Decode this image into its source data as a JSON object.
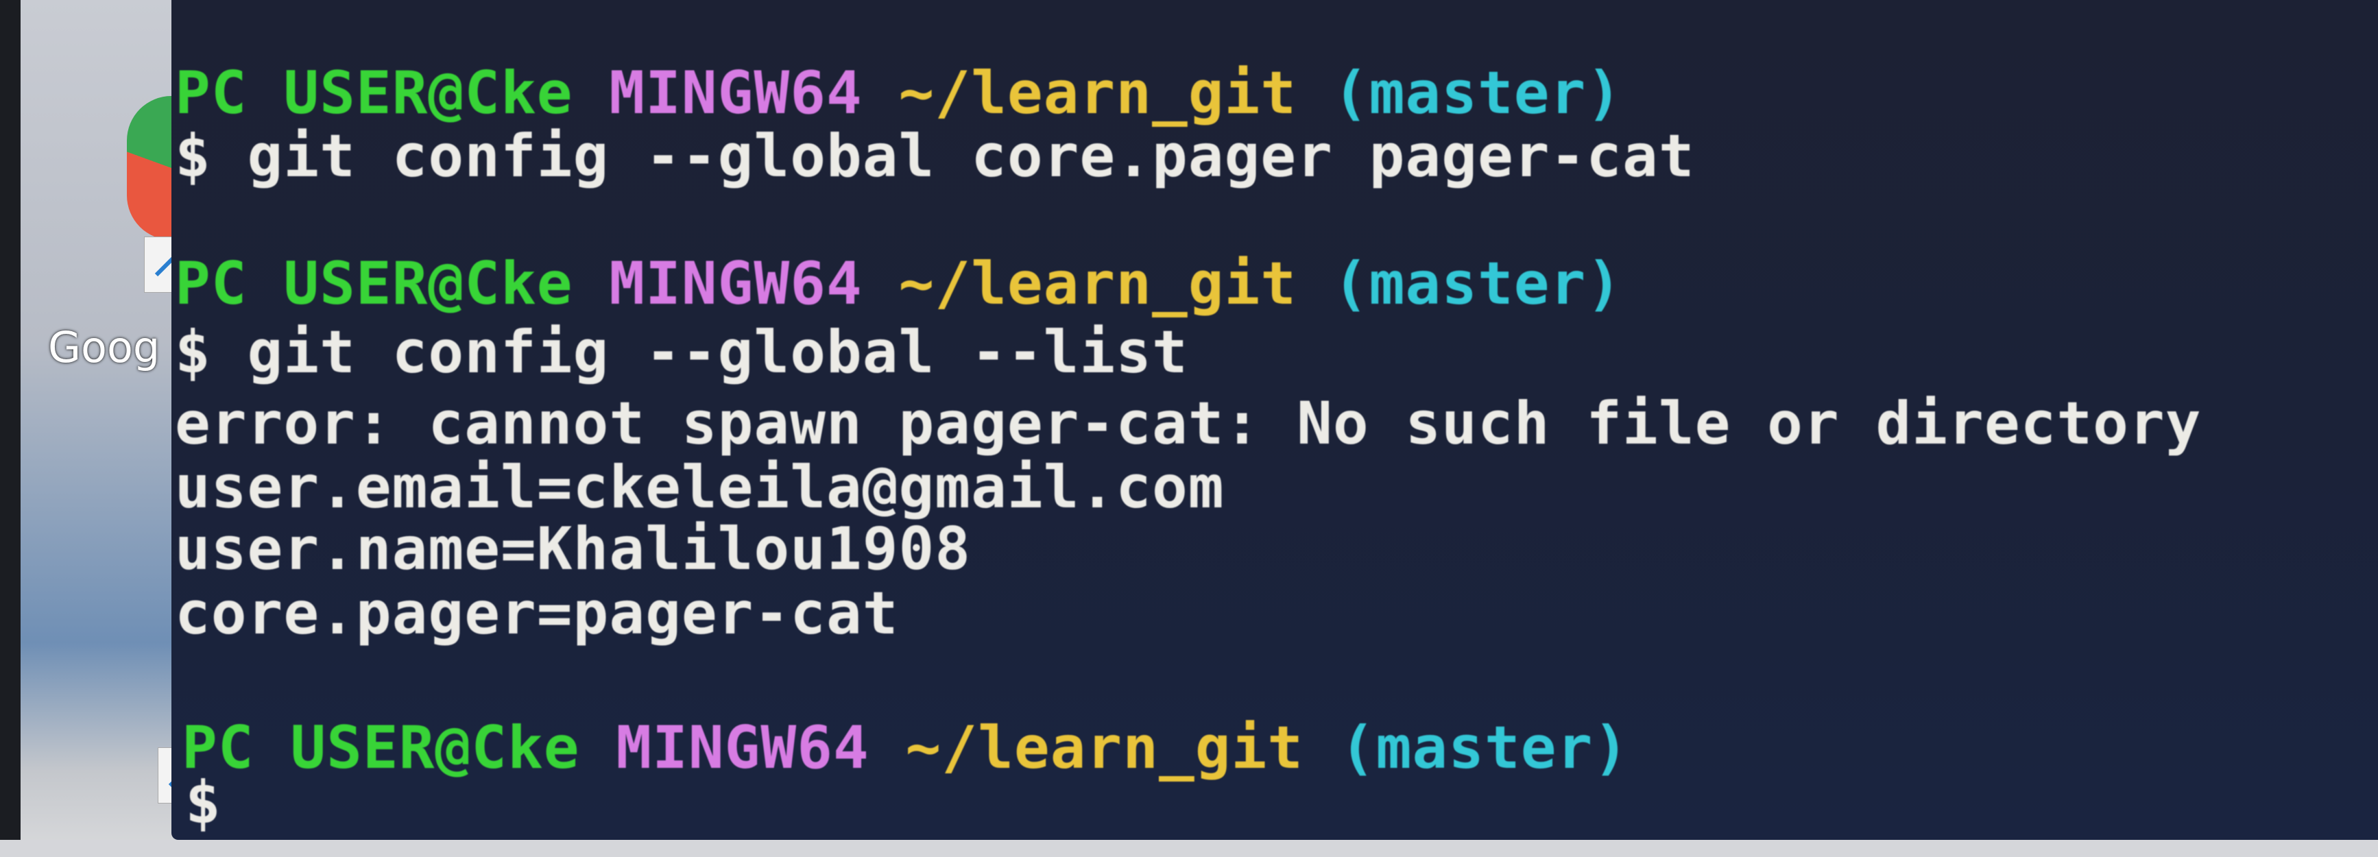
{
  "desktop": {
    "shortcut_label": "Goog"
  },
  "terminal": {
    "prompts": [
      {
        "user_host": "PC USER@Cke",
        "system": "MINGW64",
        "path": "~/learn_git",
        "branch": "(master)"
      },
      {
        "user_host": "PC USER@Cke",
        "system": "MINGW64",
        "path": "~/learn_git",
        "branch": "(master)"
      },
      {
        "user_host": "PC USER@Cke",
        "system": "MINGW64",
        "path": "~/learn_git",
        "branch": "(master)"
      }
    ],
    "commands": [
      "$ git config --global core.pager pager-cat",
      "$ git config --global --list",
      "$"
    ],
    "output": [
      "error: cannot spawn pager-cat: No such file or directory",
      "user.email=ckeleila@gmail.com",
      "user.name=Khalilou1908",
      "core.pager=pager-cat"
    ]
  },
  "colors": {
    "user_host": "#38d437",
    "system": "#d77ce3",
    "path": "#e9c43a",
    "branch": "#33c7d6",
    "text": "#ecebe6",
    "background": "#1b2238"
  }
}
